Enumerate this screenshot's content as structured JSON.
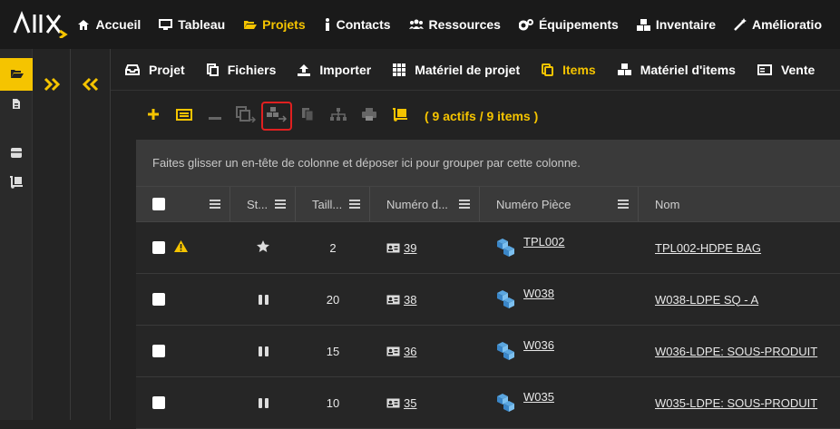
{
  "app": {
    "logo_text": "ALIX"
  },
  "topnav": [
    {
      "label": "Accueil",
      "icon": "home-icon",
      "active": false
    },
    {
      "label": "Tableau",
      "icon": "monitor-icon",
      "active": false
    },
    {
      "label": "Projets",
      "icon": "folder-open-icon",
      "active": true
    },
    {
      "label": "Contacts",
      "icon": "person-icon",
      "active": false
    },
    {
      "label": "Ressources",
      "icon": "users-icon",
      "active": false
    },
    {
      "label": "Équipements",
      "icon": "gears-icon",
      "active": false
    },
    {
      "label": "Inventaire",
      "icon": "cubes-icon",
      "active": false
    },
    {
      "label": "Amélioratio",
      "icon": "magic-wand-icon",
      "active": false
    }
  ],
  "subnav": [
    {
      "label": "Projet",
      "icon": "inbox-icon",
      "active": false
    },
    {
      "label": "Fichiers",
      "icon": "copy-icon",
      "active": false
    },
    {
      "label": "Importer",
      "icon": "upload-icon",
      "active": false
    },
    {
      "label": "Matériel de projet",
      "icon": "grid-icon",
      "active": false
    },
    {
      "label": "Items",
      "icon": "square-stack-icon",
      "active": true
    },
    {
      "label": "Matériel d'items",
      "icon": "cubes-icon",
      "active": false
    },
    {
      "label": "Vente",
      "icon": "card-icon",
      "active": false
    }
  ],
  "toolbar": {
    "count_label": "( 9 actifs / 9 items )"
  },
  "grid": {
    "group_hint": "Faites glisser un en-tête de colonne et déposer ici pour grouper par cette colonne.",
    "columns": [
      "",
      "St...",
      "Taill...",
      "Numéro d...",
      "Numéro Pièce",
      "Nom"
    ],
    "rows": [
      {
        "status": "star",
        "warning": true,
        "taille": "2",
        "numero_d": "39",
        "numero_piece": "TPL002",
        "nom": "TPL002-HDPE BAG"
      },
      {
        "status": "pause",
        "warning": false,
        "taille": "20",
        "numero_d": "38",
        "numero_piece": "W038",
        "nom": "W038-LDPE SQ - A"
      },
      {
        "status": "pause",
        "warning": false,
        "taille": "15",
        "numero_d": "36",
        "numero_piece": "W036",
        "nom": "W036-LDPE: SOUS-PRODUIT"
      },
      {
        "status": "pause",
        "warning": false,
        "taille": "10",
        "numero_d": "35",
        "numero_piece": "W035",
        "nom": "W035-LDPE: SOUS-PRODUIT"
      }
    ]
  },
  "colors": {
    "accent": "#f5c400",
    "background": "#222222",
    "highlight": "#e02020"
  }
}
